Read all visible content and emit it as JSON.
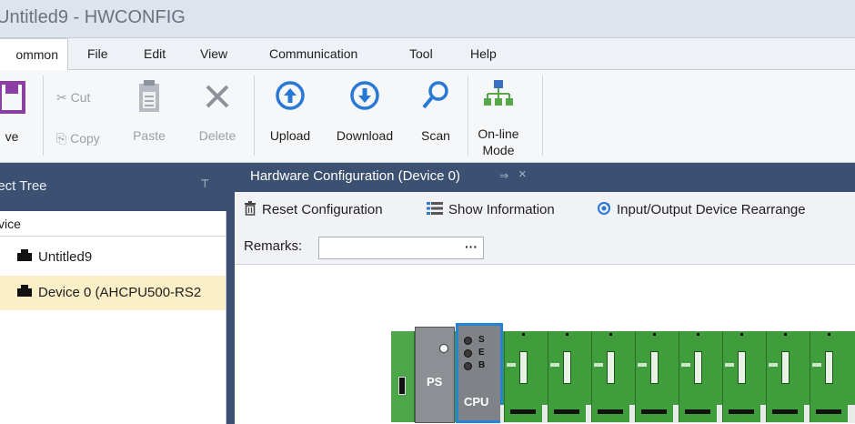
{
  "window": {
    "title": "Untitled9 - HWCONFIG"
  },
  "menu": {
    "items": [
      "ommon",
      "File",
      "Edit",
      "View",
      "Communication",
      "Tool",
      "Help"
    ]
  },
  "ribbon": {
    "save_label": "ve",
    "cut_label": "Cut",
    "copy_label": "Copy",
    "paste_label": "Paste",
    "delete_label": "Delete",
    "upload_label": "Upload",
    "download_label": "Download",
    "scan_label": "Scan",
    "online_label_line1": "On-line",
    "online_label_line2": "Mode",
    "colors": {
      "save": "#8b3ea3",
      "accent": "#2a78d6",
      "online": "#5aa64a"
    }
  },
  "project_tree": {
    "title": "ject Tree",
    "pin": "⊤",
    "column_header": "vice",
    "items": [
      {
        "label": "Untitled9",
        "selected": false
      },
      {
        "label": "Device 0 (AHCPU500-RS2",
        "selected": true
      }
    ]
  },
  "document": {
    "tab_title": "Hardware Configuration (Device 0)",
    "tab_pin": "⇒",
    "tab_close": "×",
    "toolbar": {
      "reset": "Reset Configuration",
      "show_info": "Show Information",
      "io_rearrange": "Input/Output Device Rearrange"
    },
    "remarks_label": "Remarks:",
    "remarks_value": "",
    "remarks_button": "···"
  },
  "rack": {
    "ps_label": "PS",
    "cpu_label": "CPU",
    "cpu_leds": [
      "S",
      "E",
      "B"
    ],
    "io_slot_count": 8
  }
}
